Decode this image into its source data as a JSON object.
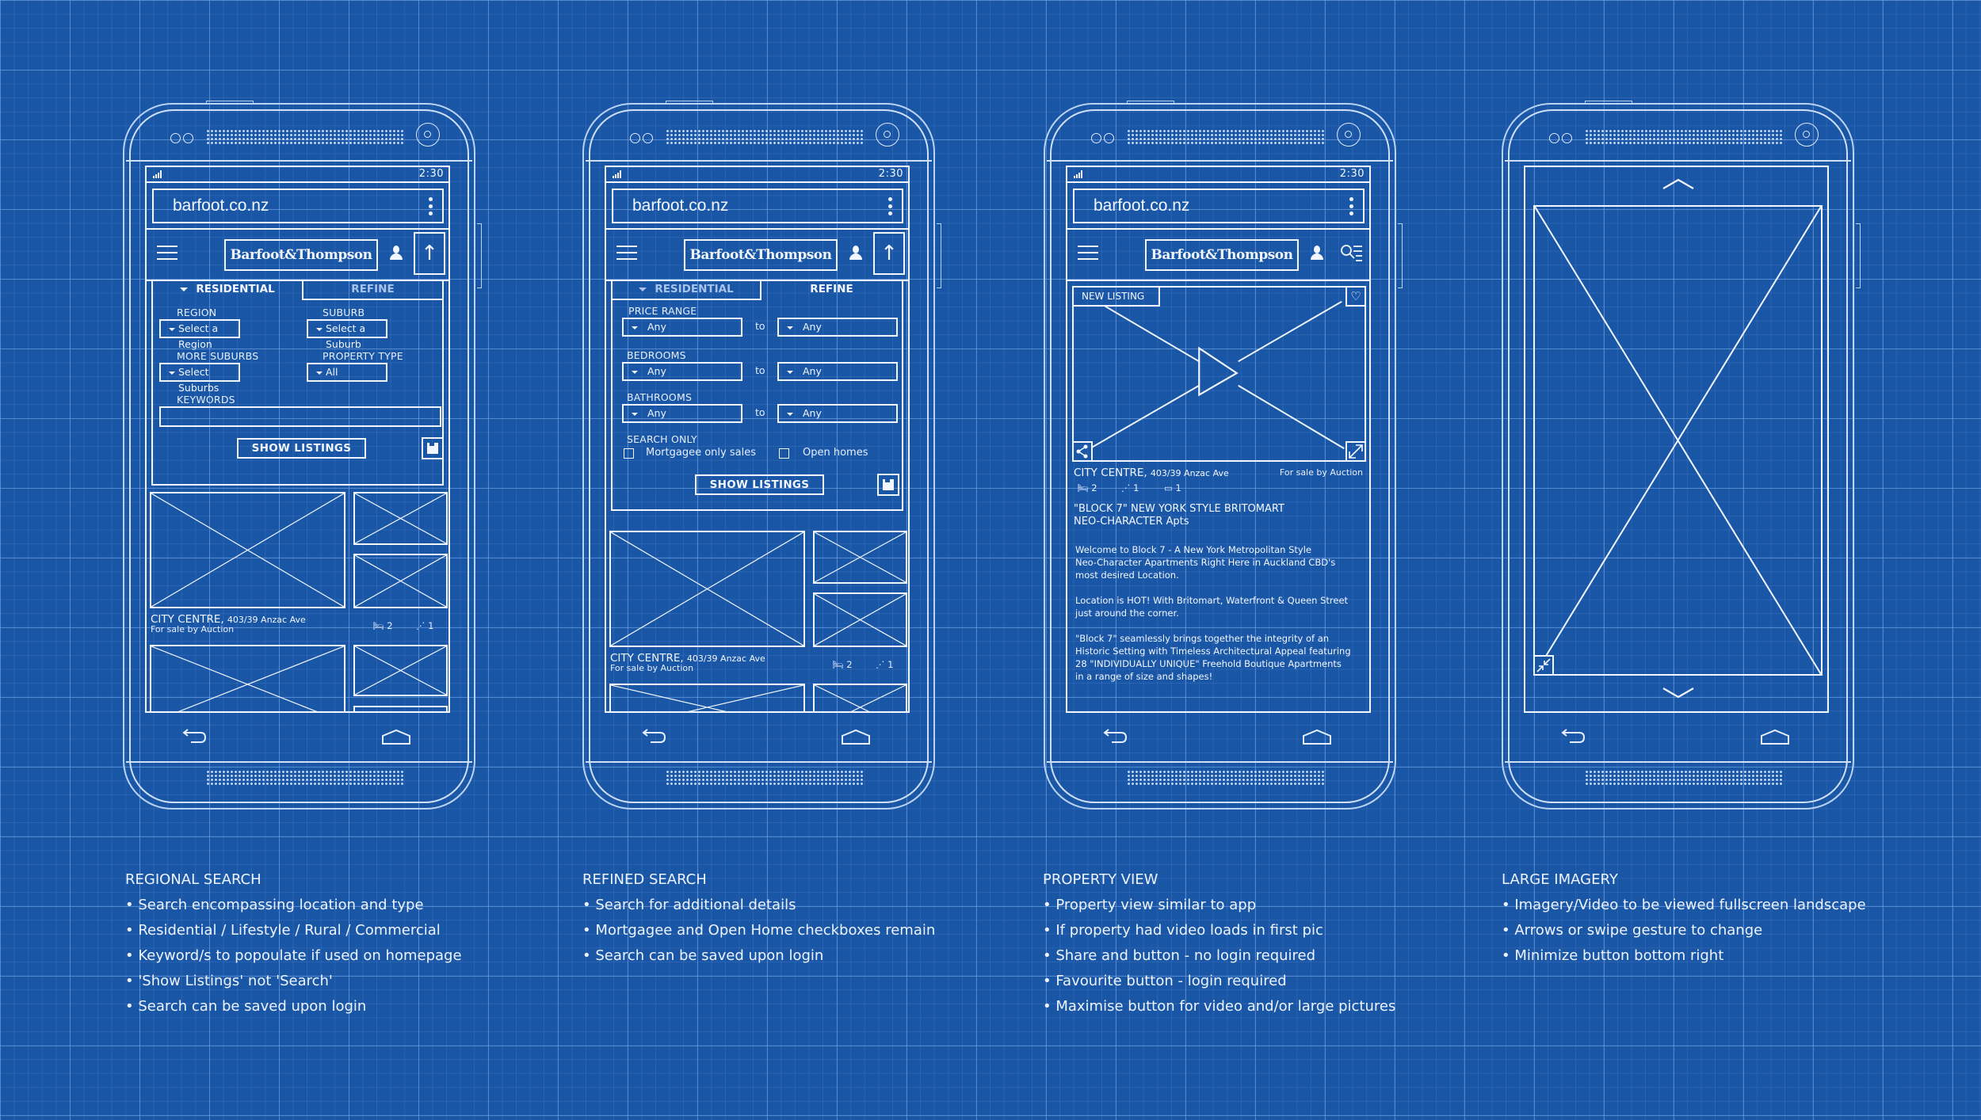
{
  "phones": [
    {
      "id": "regional-search",
      "clock": "2:30",
      "url": "barfoot.co.nz",
      "logo": "Barfoot&Thompson",
      "tabs": {
        "residential": "RESIDENTIAL",
        "refine": "REFINE"
      },
      "fields": {
        "region_label": "REGION",
        "region_value": "Select a Region",
        "suburb_label": "SUBURB",
        "suburb_value": "Select a Suburb",
        "more_suburbs_label": "MORE SUBURBS",
        "more_suburbs_value": "Select Suburbs",
        "property_type_label": "PROPERTY TYPE",
        "property_type_value": "All",
        "keywords_label": "KEYWORDS",
        "keywords_value": ""
      },
      "show_listings": "SHOW LISTINGS",
      "listing": {
        "suburb": "CITY CENTRE,",
        "address": "403/39 Anzac Ave",
        "sale": "For sale by Auction",
        "bedrooms": "2",
        "bathrooms": "1"
      }
    },
    {
      "id": "refined-search",
      "clock": "2:30",
      "url": "barfoot.co.nz",
      "logo": "Barfoot&Thompson",
      "tabs": {
        "residential": "RESIDENTIAL",
        "refine": "REFINE"
      },
      "fields": {
        "price_label": "PRICE RANGE",
        "price_from": "Any",
        "price_to": "Any",
        "bedrooms_label": "BEDROOMS",
        "bedrooms_from": "Any",
        "bedrooms_to": "Any",
        "bathrooms_label": "BATHROOMS",
        "bathrooms_from": "Any",
        "bathrooms_to": "Any",
        "to": "to",
        "search_only_label": "SEARCH ONLY",
        "mortgagee_label": "Mortgagee only sales",
        "mortgagee_checked": false,
        "open_homes_label": "Open homes",
        "open_homes_checked": false
      },
      "show_listings": "SHOW LISTINGS",
      "listing": {
        "suburb": "CITY CENTRE,",
        "address": "403/39 Anzac Ave",
        "sale": "For sale by Auction",
        "bedrooms": "2",
        "bathrooms": "1"
      }
    },
    {
      "id": "property-view",
      "clock": "2:30",
      "url": "barfoot.co.nz",
      "logo": "Barfoot&Thompson",
      "badge": "NEW LISTING",
      "listing": {
        "suburb": "CITY CENTRE,",
        "address": "403/39 Anzac Ave",
        "sale": "For sale by Auction",
        "bedrooms": "2",
        "bathrooms": "1",
        "garages": "1"
      },
      "headline_1": "\"BLOCK 7\" NEW YORK STYLE BRITOMART",
      "headline_2": "NEO-CHARACTER Apts",
      "paragraphs": [
        [
          "Welcome to Block 7 - A New York Metropolitan Style",
          "Neo-Character Apartments Right Here in Auckland CBD's",
          "most desired Location."
        ],
        [
          "Location is HOT! With Britomart, Waterfront & Queen Street",
          "just around the corner."
        ],
        [
          "\"Block 7\" seamlessly brings together the integrity of an",
          "Historic Setting with Timeless Architectural Appeal featuring",
          "28 \"INDIVIDUALLY UNIQUE\" Freehold Boutique Apartments",
          "in a range of size and shapes!"
        ]
      ]
    },
    {
      "id": "large-imagery"
    }
  ],
  "captions": [
    {
      "title": "REGIONAL SEARCH",
      "items": [
        "• Search encompassing location and type",
        "• Residential / Lifestyle / Rural / Commercial",
        "• Keyword/s to popoulate if used on homepage",
        "• 'Show Listings' not 'Search'",
        "• Search can be saved upon login"
      ]
    },
    {
      "title": "REFINED SEARCH",
      "items": [
        "• Search for additional details",
        "• Mortgagee and Open Home checkboxes remain",
        "• Search can be saved upon login"
      ]
    },
    {
      "title": "PROPERTY VIEW",
      "items": [
        "• Property view similar to app",
        "• If property had video loads in first pic",
        "• Share and button - no login required",
        "• Favourite button - login required",
        "• Maximise button for video and/or large pictures"
      ]
    },
    {
      "title": "LARGE IMAGERY",
      "items": [
        "• Imagery/Video to be viewed fullscreen landscape",
        "• Arrows or swipe gesture to change",
        "• Minimize button bottom right"
      ]
    }
  ],
  "colors": {
    "background": "#1a56a6",
    "line": "#f2f7ff",
    "grid": "#78aaeb"
  }
}
